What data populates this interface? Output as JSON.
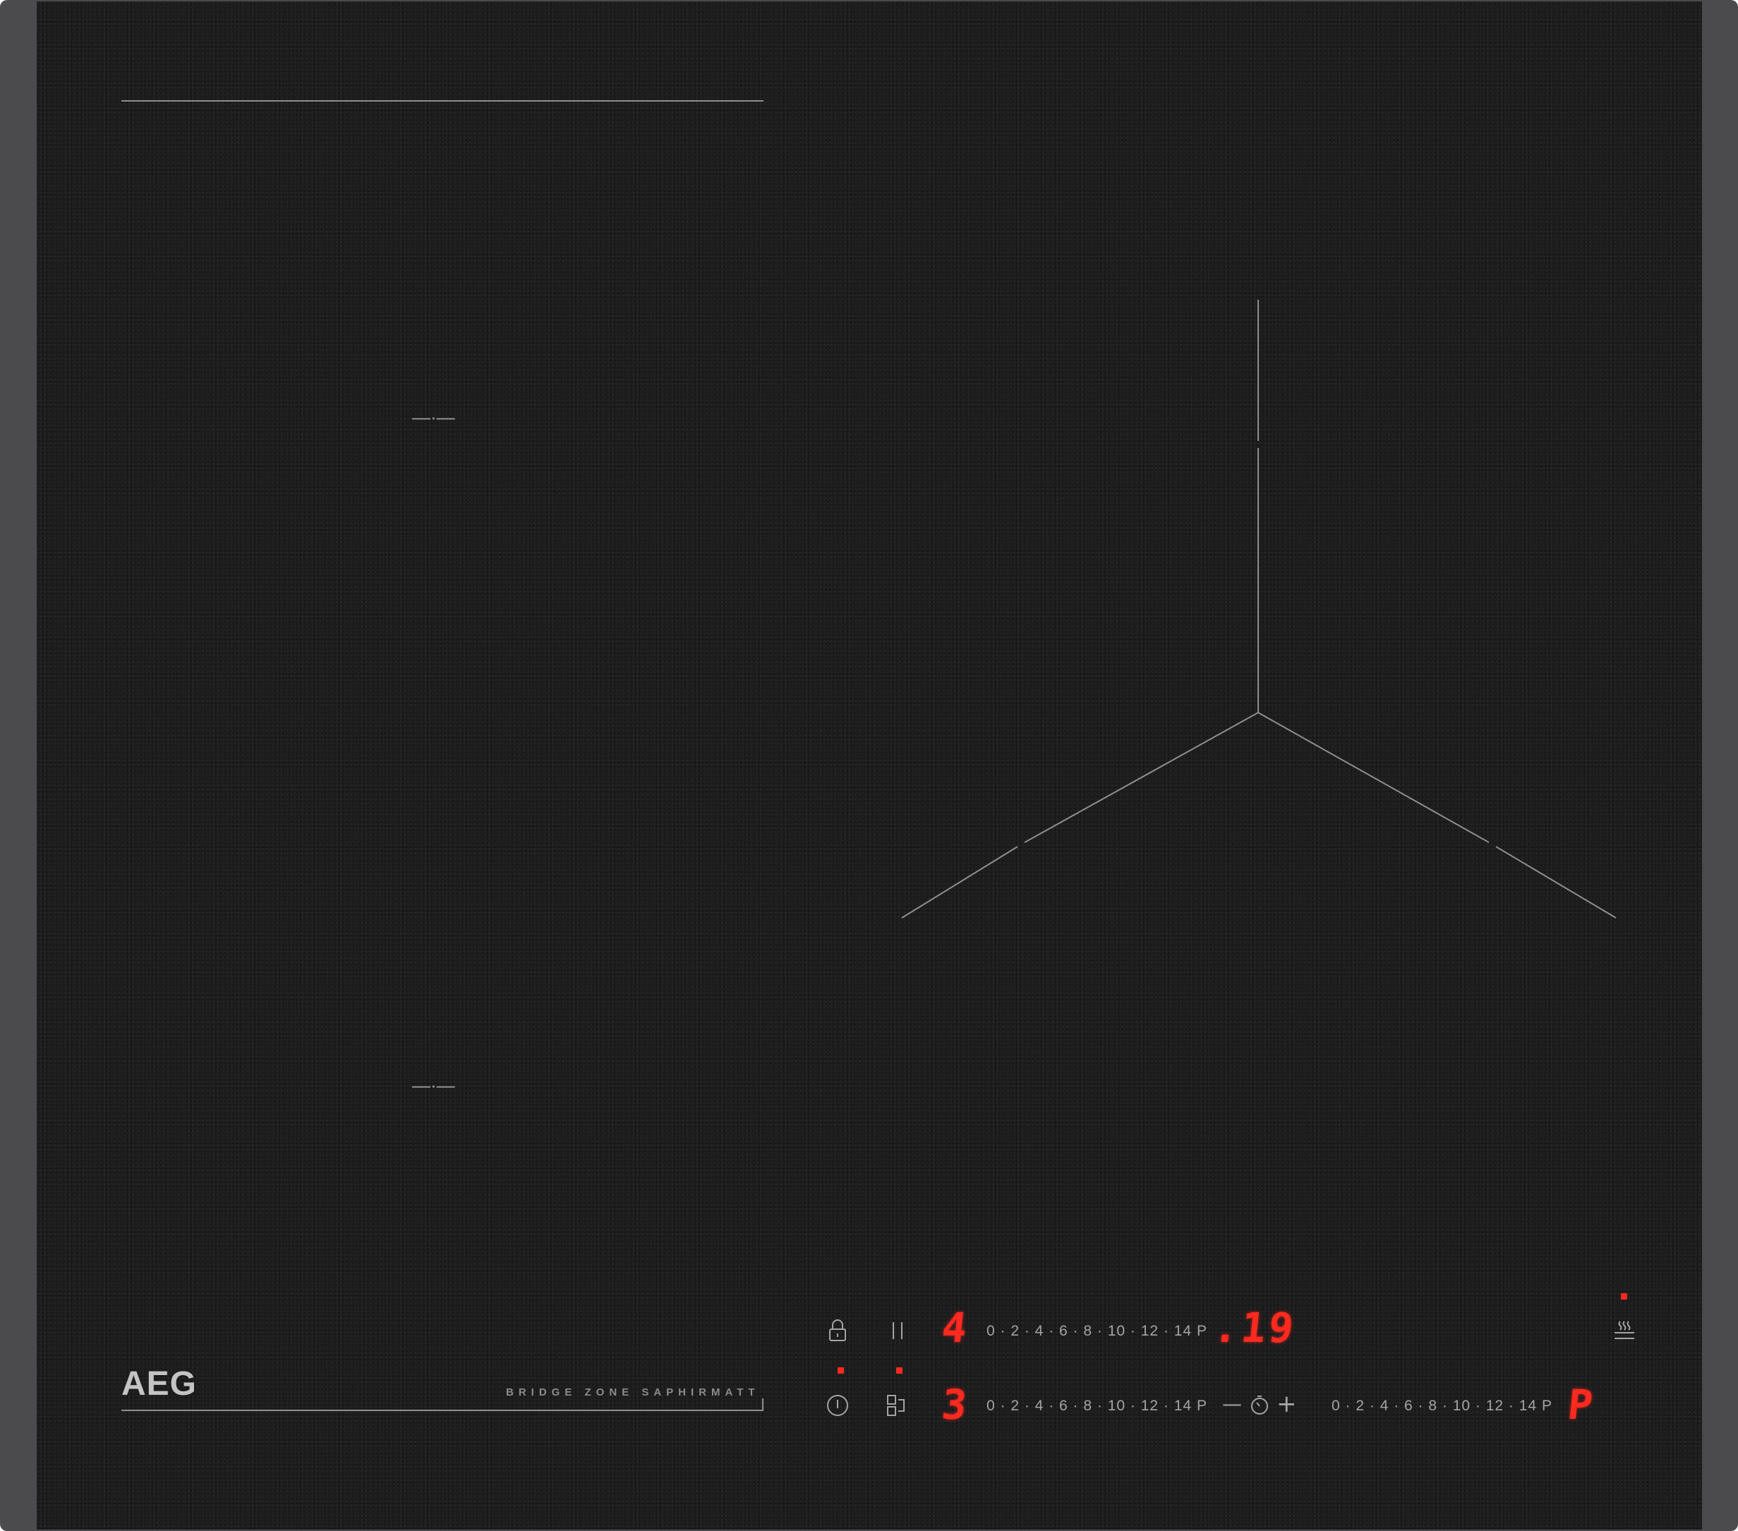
{
  "brand": {
    "logo": "AEG",
    "subtitle": "BRIDGE ZONE SAPHIRMATT"
  },
  "left_zone_markers": [
    "—·—",
    "—·—"
  ],
  "controls": {
    "row1": {
      "power_scale": "0 · 2 · 4 · 6 · 8 · 10 · 12 · 14 P",
      "zone_level": "4",
      "timer_display": ".19"
    },
    "row2": {
      "power_scale_left": "0 · 2 · 4 · 6 · 8 · 10 · 12 · 14 P",
      "zone_level": "3",
      "timer_minus": "—",
      "timer_plus": "+",
      "power_scale_right": "0 · 2 · 4 · 6 · 8 · 10 · 12 · 14 P",
      "right_zone_level": "P"
    }
  },
  "icons": [
    "lock-icon",
    "pause-icon",
    "power-icon",
    "bridge-icon",
    "timer-icon",
    "hob-hood-icon"
  ],
  "colors": {
    "glass": "#1c1c1d",
    "frame": "#4b4b4d",
    "led": "#ff2a1f",
    "print": "#8f8f90"
  }
}
